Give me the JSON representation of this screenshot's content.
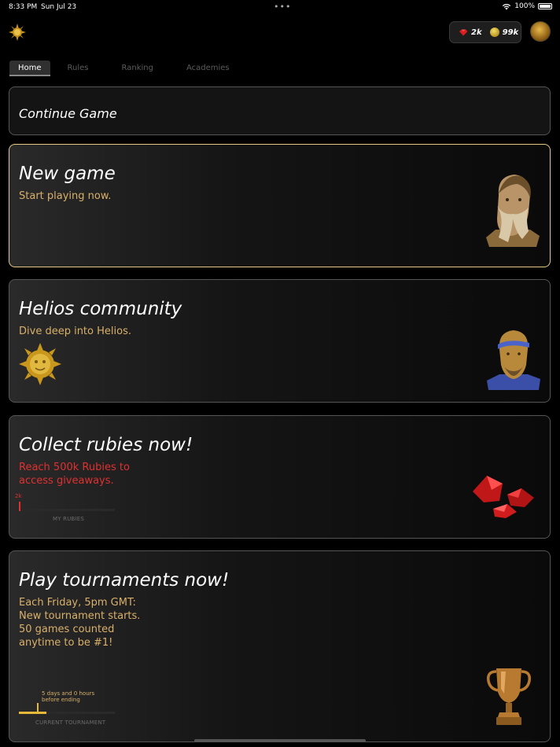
{
  "status_bar": {
    "time": "8:33 PM",
    "date": "Sun Jul 23",
    "dots": "•••",
    "battery": "100%"
  },
  "header": {
    "rubies": "2k",
    "coins": "99k"
  },
  "tabs": [
    {
      "label": "Home",
      "active": true
    },
    {
      "label": "Rules",
      "active": false
    },
    {
      "label": "Ranking",
      "active": false
    },
    {
      "label": "Academies",
      "active": false
    }
  ],
  "cards": {
    "continue": {
      "title": "Continue Game"
    },
    "new_game": {
      "title": "New game",
      "subtitle": "Start playing now."
    },
    "community": {
      "title": "Helios community",
      "subtitle": "Dive deep into Helios."
    },
    "rubies": {
      "title": "Collect rubies now!",
      "subtitle_line1": "Reach 500k Rubies to",
      "subtitle_line2": "access giveaways.",
      "progress_value": "2k",
      "progress_fraction": 0.004,
      "caption": "MY RUBIES"
    },
    "tournament": {
      "title": "Play tournaments now!",
      "line1": "Each Friday, 5pm GMT:",
      "line2": "New tournament starts.",
      "line3": "50 games counted",
      "line4": "anytime to be #1!",
      "time_line1": "5 days and 0 hours",
      "time_line2": "before ending",
      "progress_fraction": 0.29,
      "caption": "CURRENT TOURNAMENT"
    }
  },
  "colors": {
    "accent_gold": "#d9b06a",
    "ruby_red": "#e03030",
    "bar_gold": "#e6b938",
    "highlight_border": "#e6c982"
  },
  "icons": [
    "sun-logo-icon",
    "wifi-icon",
    "battery-icon",
    "ruby-icon",
    "coin-icon",
    "trophy-icon"
  ]
}
